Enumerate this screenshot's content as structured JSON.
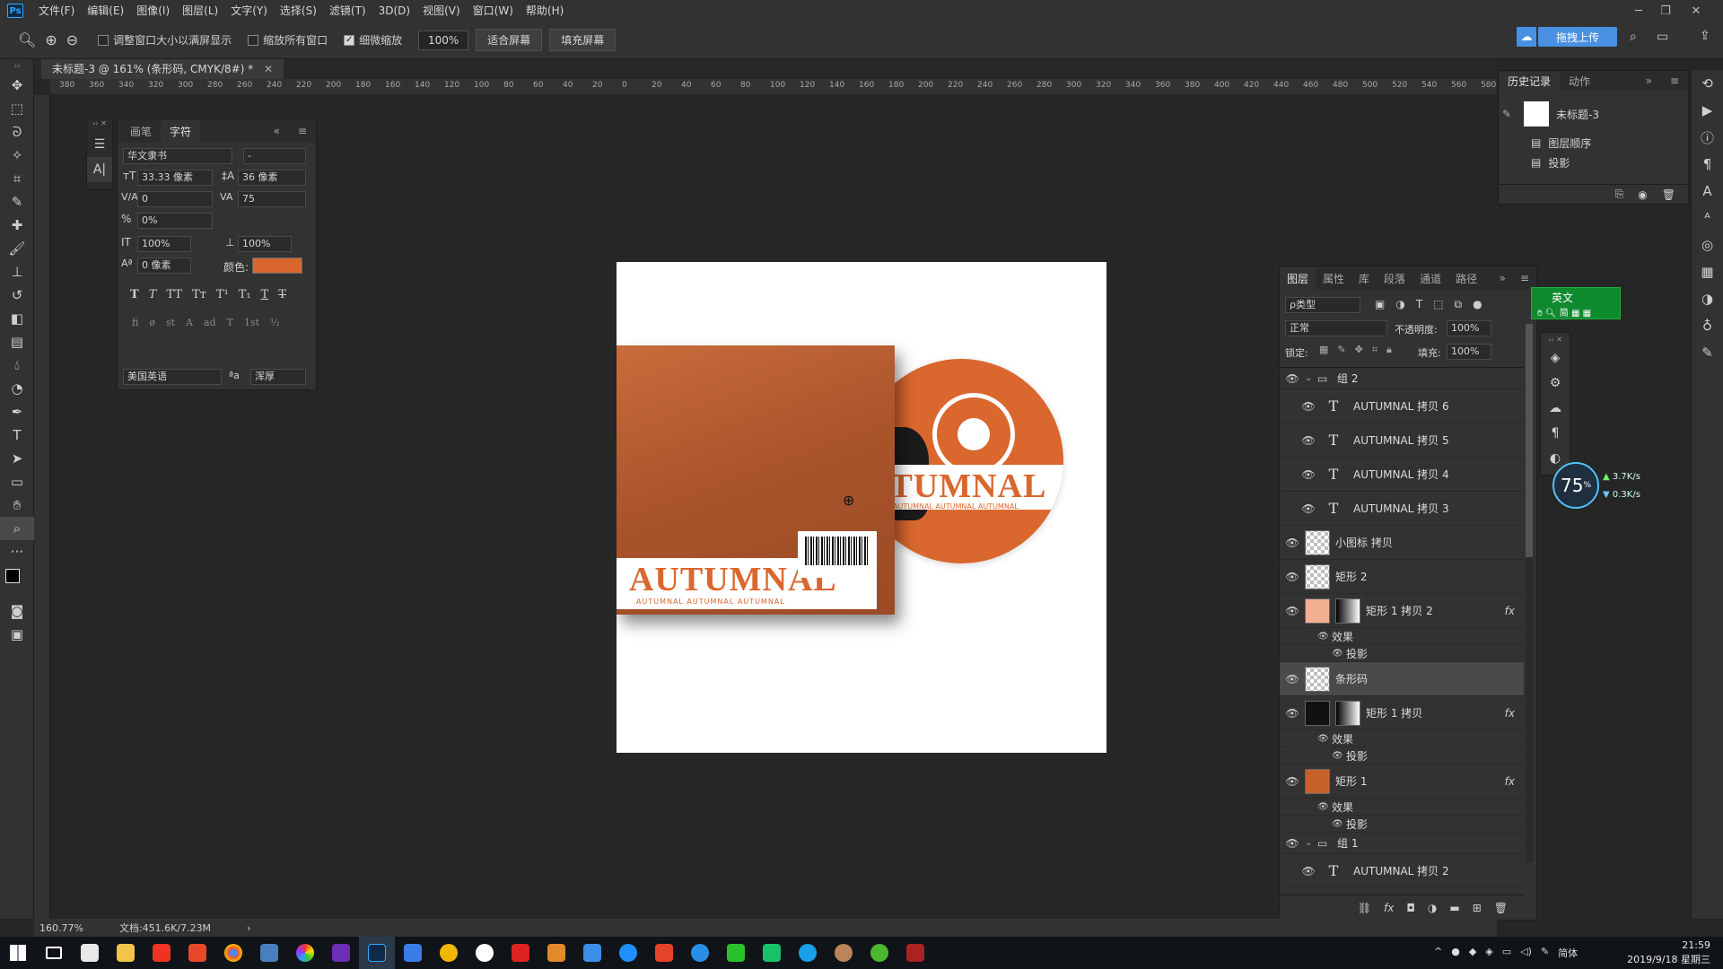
{
  "menubar": {
    "logo": "Ps",
    "items": [
      "文件(F)",
      "编辑(E)",
      "图像(I)",
      "图层(L)",
      "文字(Y)",
      "选择(S)",
      "滤镜(T)",
      "3D(D)",
      "视图(V)",
      "窗口(W)",
      "帮助(H)"
    ]
  },
  "options_bar": {
    "resize_windows_label": "调整窗口大小以满屏显示",
    "zoom_all_label": "缩放所有窗口",
    "scrubby_label": "细微缩放",
    "zoom_value": "100%",
    "fit_screen": "适合屏幕",
    "fill_screen": "填充屏幕",
    "upload": "拖拽上传"
  },
  "document": {
    "tab_title": "未标题-3 @ 161% (条形码, CMYK/8#) *",
    "ruler_ticks": [
      "380",
      "360",
      "340",
      "320",
      "300",
      "280",
      "260",
      "240",
      "220",
      "200",
      "180",
      "160",
      "140",
      "120",
      "100",
      "80",
      "60",
      "40",
      "20",
      "0",
      "20",
      "40",
      "60",
      "80",
      "100",
      "120",
      "140",
      "160",
      "180",
      "200",
      "220",
      "240",
      "260",
      "280",
      "300",
      "320",
      "340",
      "360",
      "380",
      "400",
      "420",
      "440",
      "460",
      "480",
      "500",
      "520",
      "540",
      "560",
      "580"
    ],
    "status_zoom": "160.77%",
    "status_doc": "文档:451.6K/7.23M"
  },
  "artwork": {
    "cover_title": "AUTUMNAL",
    "disc_title": "UTUMNAL",
    "sub_text": "AUTUMNAL  AUTUMNAL  AUTUMNAL"
  },
  "character_panel": {
    "tabs": [
      "画笔",
      "字符"
    ],
    "font_family": "华文隶书",
    "font_style": "-",
    "font_size": "33.33 像素",
    "leading": "36 像素",
    "kerning": "0",
    "tracking": "75",
    "tsume": "0%",
    "vertical_scale": "100%",
    "horizontal_scale": "100%",
    "baseline": "0 像素",
    "color_label": "颜色:",
    "color": "#d9672e",
    "format_buttons": [
      "T",
      "T",
      "TT",
      "Tт",
      "T¹",
      "T₁",
      "T",
      "T"
    ],
    "opentype_buttons": [
      "fi",
      "ø",
      "st",
      "A",
      "ad",
      "T",
      "1st",
      "½"
    ],
    "language": "美国英语",
    "aa_label": "ªa",
    "antialias": "浑厚"
  },
  "history_panel": {
    "tabs": [
      "历史记录",
      "动作"
    ],
    "snapshot": "未标题-3",
    "items": [
      "图层顺序",
      "投影"
    ]
  },
  "layers_panel": {
    "tabs": [
      "图层",
      "属性",
      "库",
      "段落",
      "通道",
      "路径"
    ],
    "filter_label": "ρ类型",
    "blend_mode": "正常",
    "opacity_label": "不透明度:",
    "opacity": "100%",
    "lock_label": "锁定:",
    "fill_label": "填充:",
    "fill": "100%",
    "layers": [
      {
        "name": "组 2",
        "kind": "group"
      },
      {
        "name": "AUTUMNAL 拷贝 6",
        "kind": "text"
      },
      {
        "name": "AUTUMNAL 拷贝 5",
        "kind": "text"
      },
      {
        "name": "AUTUMNAL 拷贝 4",
        "kind": "text"
      },
      {
        "name": "AUTUMNAL 拷贝 3",
        "kind": "text"
      },
      {
        "name": "小图标 拷贝",
        "kind": "image"
      },
      {
        "name": "矩形 2",
        "kind": "image"
      },
      {
        "name": "矩形 1 拷贝 2",
        "kind": "mask",
        "fx": "fx"
      },
      {
        "name": "效果",
        "kind": "effect"
      },
      {
        "name": "投影",
        "kind": "effect"
      },
      {
        "name": "条形码",
        "kind": "image",
        "selected": true
      },
      {
        "name": "矩形 1 拷贝",
        "kind": "mask",
        "fx": "fx"
      },
      {
        "name": "效果",
        "kind": "effect"
      },
      {
        "name": "投影",
        "kind": "effect"
      },
      {
        "name": "矩形 1",
        "kind": "color",
        "fx": "fx"
      },
      {
        "name": "效果",
        "kind": "effect"
      },
      {
        "name": "投影",
        "kind": "effect"
      },
      {
        "name": "组 1",
        "kind": "group"
      },
      {
        "name": "AUTUMNAL 拷贝 2",
        "kind": "text"
      }
    ]
  },
  "ime": {
    "mode": "英文",
    "row2": "简"
  },
  "speed_widget": {
    "percent": "75",
    "up": "3.7K/s",
    "down": "0.3K/s"
  },
  "taskbar": {
    "time": "21:59",
    "date": "2019/9/18 星期三",
    "lang": "简体"
  }
}
